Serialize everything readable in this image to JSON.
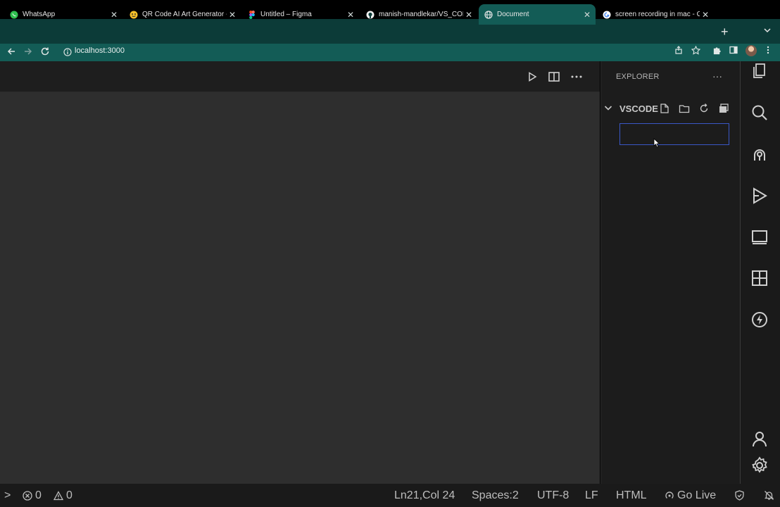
{
  "browser": {
    "tabs": [
      {
        "title": "WhatsApp",
        "icon": "whatsapp-icon",
        "active": false
      },
      {
        "title": "QR Code AI Art Generator -",
        "icon": "huggingface-icon",
        "active": false
      },
      {
        "title": "Untitled – Figma",
        "icon": "figma-icon",
        "active": false
      },
      {
        "title": "manish-mandlekar/VS_COD",
        "icon": "github-icon",
        "active": false
      },
      {
        "title": "Document",
        "icon": "globe-icon",
        "active": true
      },
      {
        "title": "screen recording in mac - G",
        "icon": "google-icon",
        "active": false
      }
    ],
    "close_glyph": "✕",
    "new_tab_glyph": "+",
    "url": "localhost:3000"
  },
  "explorer": {
    "title": "EXPLORER",
    "more": "···",
    "folder_name": "VSCODE",
    "new_item_value": ""
  },
  "statusbar": {
    "prompt": ">",
    "errors": "0",
    "warnings": "0",
    "position": "Ln21,Col 24",
    "spaces": "Spaces:2",
    "encoding": "UTF-8",
    "eol": "LF",
    "language": "HTML",
    "go_live": "Go Live"
  },
  "colors": {
    "tabbar": "#0c3b38",
    "active_tab": "#135c56",
    "editor_bg": "#2e2e2e",
    "sidebar_bg": "#1c1c1c",
    "input_border": "#3a57c7"
  }
}
